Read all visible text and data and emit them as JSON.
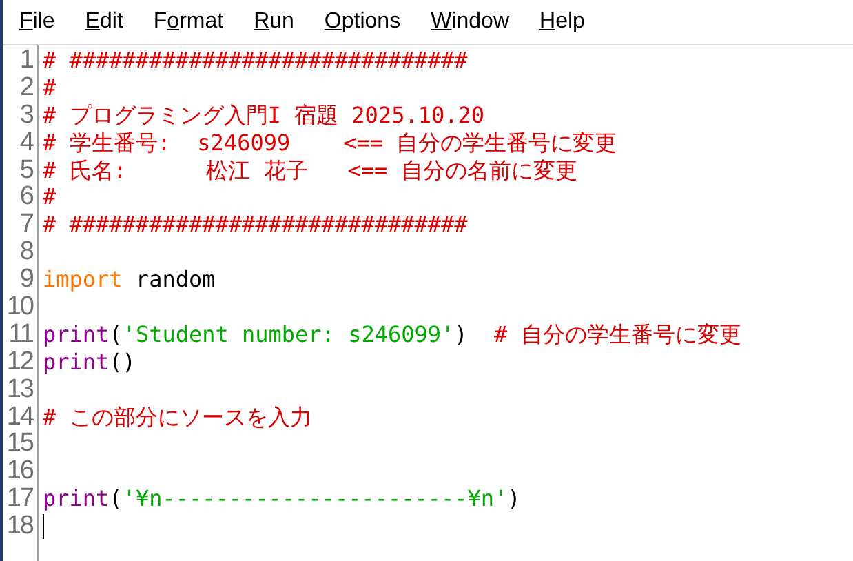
{
  "menu": [
    {
      "key": "F",
      "after": "ile"
    },
    {
      "key": "E",
      "after": "dit"
    },
    {
      "before": "F",
      "key": "o",
      "after": "rmat"
    },
    {
      "key": "R",
      "after": "un"
    },
    {
      "key": "O",
      "after": "ptions"
    },
    {
      "key": "W",
      "after": "indow"
    },
    {
      "key": "H",
      "after": "elp"
    }
  ],
  "editor": {
    "lines": [
      {
        "number": "1",
        "cursor": false,
        "segments": [
          {
            "kind": "comment",
            "text": "# ##############################"
          }
        ]
      },
      {
        "number": "2",
        "cursor": false,
        "segments": [
          {
            "kind": "comment",
            "text": "#"
          }
        ]
      },
      {
        "number": "3",
        "cursor": false,
        "segments": [
          {
            "kind": "comment",
            "text": "# プログラミング入門I 宿題 2025.10.20"
          }
        ]
      },
      {
        "number": "4",
        "cursor": false,
        "segments": [
          {
            "kind": "comment",
            "text": "# 学生番号:  s246099    <== 自分の学生番号に変更"
          }
        ]
      },
      {
        "number": "5",
        "cursor": false,
        "segments": [
          {
            "kind": "comment",
            "text": "# 氏名:      松江 花子   <== 自分の名前に変更"
          }
        ]
      },
      {
        "number": "6",
        "cursor": false,
        "segments": [
          {
            "kind": "comment",
            "text": "#"
          }
        ]
      },
      {
        "number": "7",
        "cursor": false,
        "segments": [
          {
            "kind": "comment",
            "text": "# ##############################"
          }
        ]
      },
      {
        "number": "8",
        "cursor": false
      },
      {
        "number": "9",
        "cursor": false,
        "segments": [
          {
            "kind": "keyword",
            "text": "import"
          },
          {
            "kind": "plain",
            "text": " random"
          }
        ]
      },
      {
        "number": "10",
        "cursor": false
      },
      {
        "number": "11",
        "cursor": false,
        "segments": [
          {
            "kind": "builtin",
            "text": "print"
          },
          {
            "kind": "plain",
            "text": "("
          },
          {
            "kind": "string",
            "text": "'Student number: s246099'"
          },
          {
            "kind": "plain",
            "text": ")  "
          },
          {
            "kind": "comment",
            "text": "# 自分の学生番号に変更"
          }
        ]
      },
      {
        "number": "12",
        "cursor": false,
        "segments": [
          {
            "kind": "builtin",
            "text": "print"
          },
          {
            "kind": "plain",
            "text": "()"
          }
        ]
      },
      {
        "number": "13",
        "cursor": false
      },
      {
        "number": "14",
        "cursor": false,
        "segments": [
          {
            "kind": "comment",
            "text": "# この部分にソースを入力"
          }
        ]
      },
      {
        "number": "15",
        "cursor": false
      },
      {
        "number": "16",
        "cursor": false
      },
      {
        "number": "17",
        "cursor": false,
        "segments": [
          {
            "kind": "builtin",
            "text": "print"
          },
          {
            "kind": "plain",
            "text": "("
          },
          {
            "kind": "string",
            "text": "'¥n-----------------------¥n'"
          },
          {
            "kind": "plain",
            "text": ")"
          }
        ]
      },
      {
        "number": "18",
        "cursor": true
      }
    ]
  }
}
